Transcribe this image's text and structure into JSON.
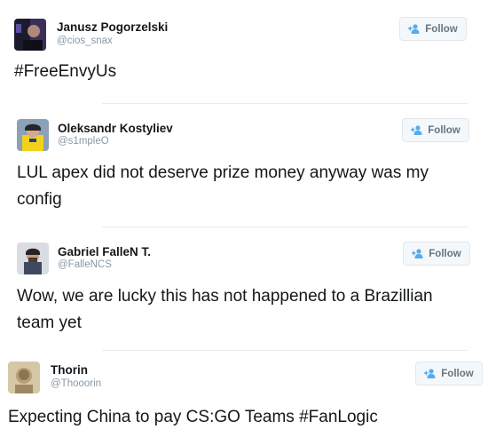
{
  "colors": {
    "name": "#14171a",
    "handle": "#8899a6",
    "follow_icon": "#55acee",
    "follow_text": "#66757f",
    "separator": "#e6ecf0"
  },
  "icons": {
    "follow": "person-plus-icon"
  },
  "tweets": [
    {
      "name": "Janusz Pogorzelski",
      "handle": "@cios_snax",
      "follow_label": "Follow",
      "text": "#FreeEnvyUs"
    },
    {
      "name": "Oleksandr Kostyliev",
      "handle": "@s1mpleO",
      "follow_label": "Follow",
      "text": "LUL apex did not deserve prize money anyway was my config"
    },
    {
      "name": "Gabriel FalleN T.",
      "handle": "@FalleNCS",
      "follow_label": "Follow",
      "text": "Wow, we are lucky this has not happened to a Brazillian team yet"
    },
    {
      "name": "Thorin",
      "handle": "@Thooorin",
      "follow_label": "Follow",
      "text": "Expecting China to pay CS:GO Teams #FanLogic"
    }
  ]
}
